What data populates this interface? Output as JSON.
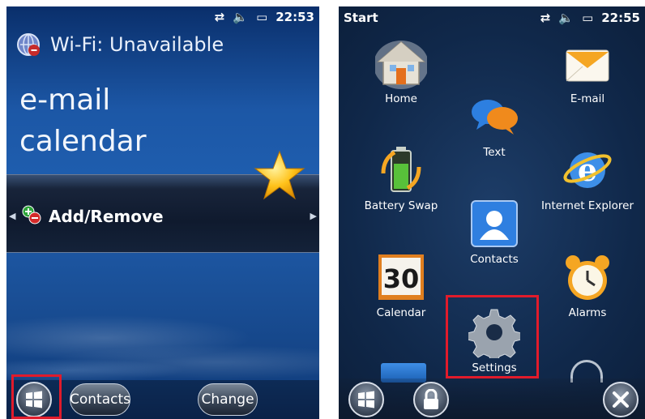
{
  "left": {
    "status": {
      "time": "22:53"
    },
    "wifi": "Wi-Fi: Unavailable",
    "lines": [
      "e-mail",
      "calendar"
    ],
    "add_remove": "Add/Remove",
    "softkeys": {
      "contacts": "Contacts",
      "change": "Change"
    }
  },
  "right": {
    "status": {
      "title": "Start",
      "time": "22:55"
    },
    "tiles": {
      "home": "Home",
      "email": "E-mail",
      "text": "Text",
      "battery": "Battery Swap",
      "ie": "Internet Explorer",
      "contacts": "Contacts",
      "calendar": "Calendar",
      "calendar_day": "30",
      "alarms": "Alarms",
      "settings": "Settings"
    }
  },
  "colors": {
    "highlight_box": "#e11b2b",
    "accent_blue": "#1f5fb0"
  },
  "icons": [
    "windows-start-icon",
    "lock-icon",
    "close-icon",
    "sync-icon",
    "speaker-icon",
    "battery-icon",
    "wifi-globe-icon",
    "star-icon"
  ]
}
